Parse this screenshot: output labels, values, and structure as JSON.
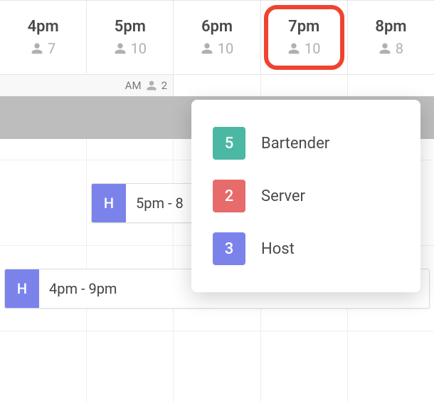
{
  "timeline": [
    {
      "label": "4pm",
      "count": "7",
      "highlighted": false
    },
    {
      "label": "5pm",
      "count": "10",
      "highlighted": false
    },
    {
      "label": "6pm",
      "count": "10",
      "highlighted": false
    },
    {
      "label": "7pm",
      "count": "10",
      "highlighted": true
    },
    {
      "label": "8pm",
      "count": "8",
      "highlighted": false
    }
  ],
  "ampm": {
    "label": "AM",
    "count": "2"
  },
  "shifts": {
    "row2": {
      "badge": "H",
      "text": "5pm - 8"
    },
    "row3": {
      "badge": "H",
      "text": "4pm - 9pm"
    }
  },
  "popover": [
    {
      "count": "5",
      "label": "Bartender",
      "colorClass": "c-teal"
    },
    {
      "count": "2",
      "label": "Server",
      "colorClass": "c-red"
    },
    {
      "count": "3",
      "label": "Host",
      "colorClass": "c-purple"
    }
  ],
  "colors": {
    "highlight": "#f0432f",
    "teal": "#4bb8a3",
    "red": "#e76b6b",
    "purple": "#7b83eb"
  }
}
